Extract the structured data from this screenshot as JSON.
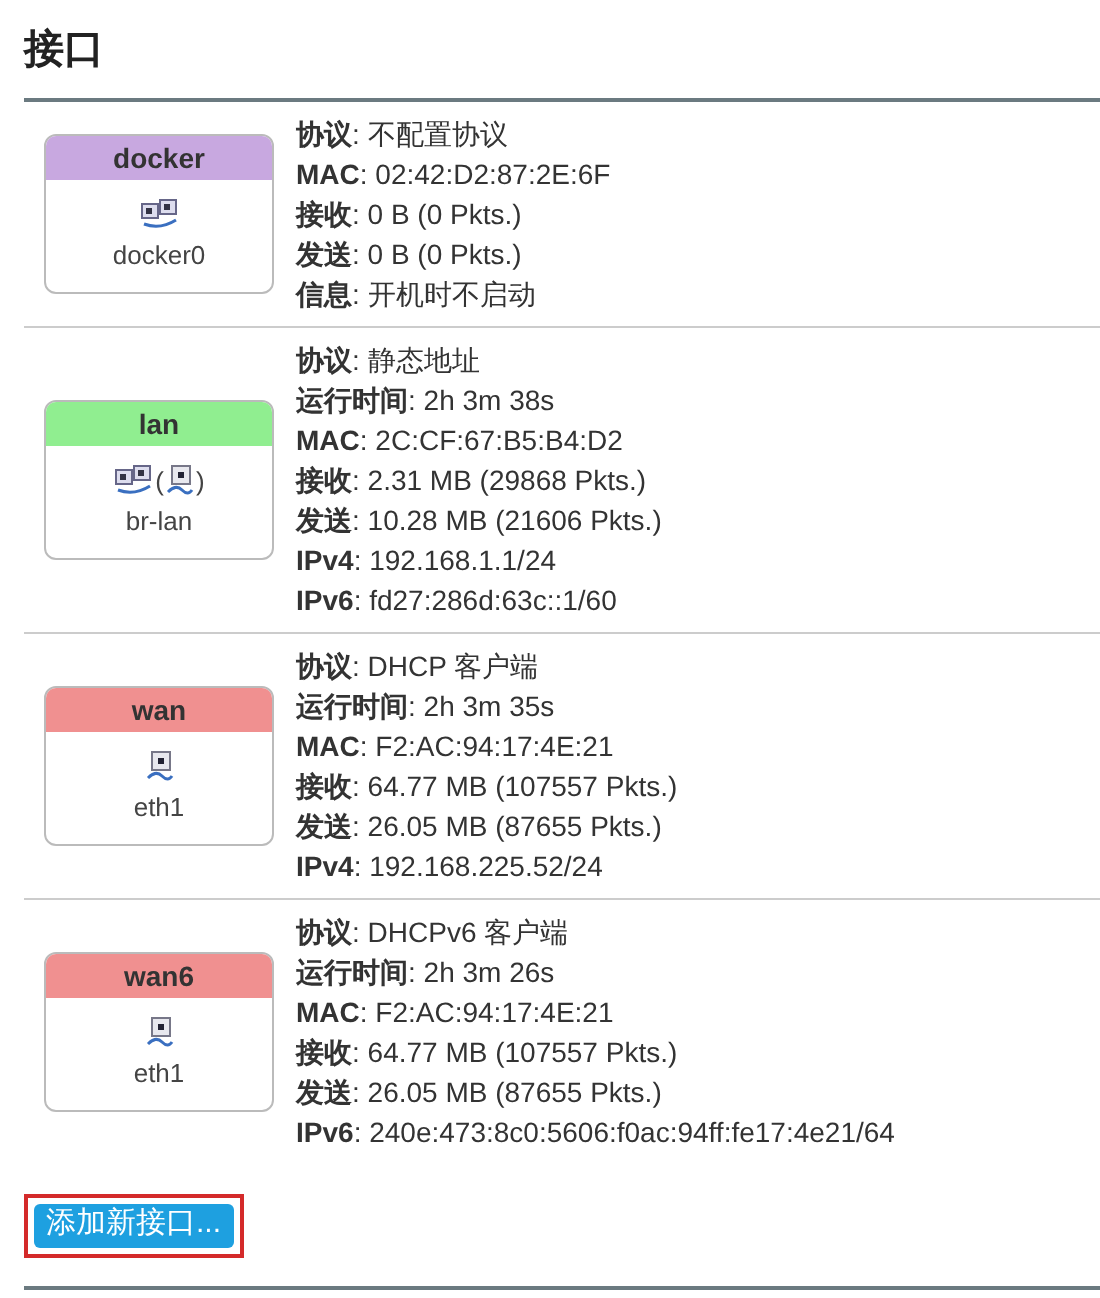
{
  "title": "接口",
  "interfaces": [
    {
      "name": "docker",
      "color": "#c8a8e0",
      "icons": [
        {
          "kind": "bridge"
        }
      ],
      "device": "docker0",
      "lines": [
        "**协议**: 不配置协议",
        "**MAC**: 02:42:D2:87:2E:6F",
        "**接收**: 0 B (0 Pkts.)",
        "**发送**: 0 B (0 Pkts.)",
        "**信息**: 开机时不启动"
      ]
    },
    {
      "name": "lan",
      "color": "#90ee90",
      "icons": [
        {
          "kind": "bridge"
        },
        {
          "kind": "text",
          "text": "("
        },
        {
          "kind": "port"
        },
        {
          "kind": "text",
          "text": ")"
        }
      ],
      "device": "br-lan",
      "lines": [
        "**协议**: 静态地址",
        "**运行时间**: 2h 3m 38s",
        "**MAC**: 2C:CF:67:B5:B4:D2",
        "**接收**: 2.31 MB (29868 Pkts.)",
        "**发送**: 10.28 MB (21606 Pkts.)",
        "**IPv4**: 192.168.1.1/24",
        "**IPv6**: fd27:286d:63c::1/60"
      ]
    },
    {
      "name": "wan",
      "color": "#f09090",
      "icons": [
        {
          "kind": "port"
        }
      ],
      "device": "eth1",
      "lines": [
        "**协议**: DHCP 客户端",
        "**运行时间**: 2h 3m 35s",
        "**MAC**: F2:AC:94:17:4E:21",
        "**接收**: 64.77 MB (107557 Pkts.)",
        "**发送**: 26.05 MB (87655 Pkts.)",
        "**IPv4**: 192.168.225.52/24"
      ]
    },
    {
      "name": "wan6",
      "color": "#f09090",
      "icons": [
        {
          "kind": "port"
        }
      ],
      "device": "eth1",
      "lines": [
        "**协议**: DHCPv6 客户端",
        "**运行时间**: 2h 3m 26s",
        "**MAC**: F2:AC:94:17:4E:21",
        "**接收**: 64.77 MB (107557 Pkts.)",
        "**发送**: 26.05 MB (87655 Pkts.)",
        "**IPv6**: 240e:473:8c0:5606:f0ac:94ff:fe17:4e21/64"
      ]
    }
  ],
  "add_button": {
    "label": "添加新接口...",
    "highlighted": true
  }
}
